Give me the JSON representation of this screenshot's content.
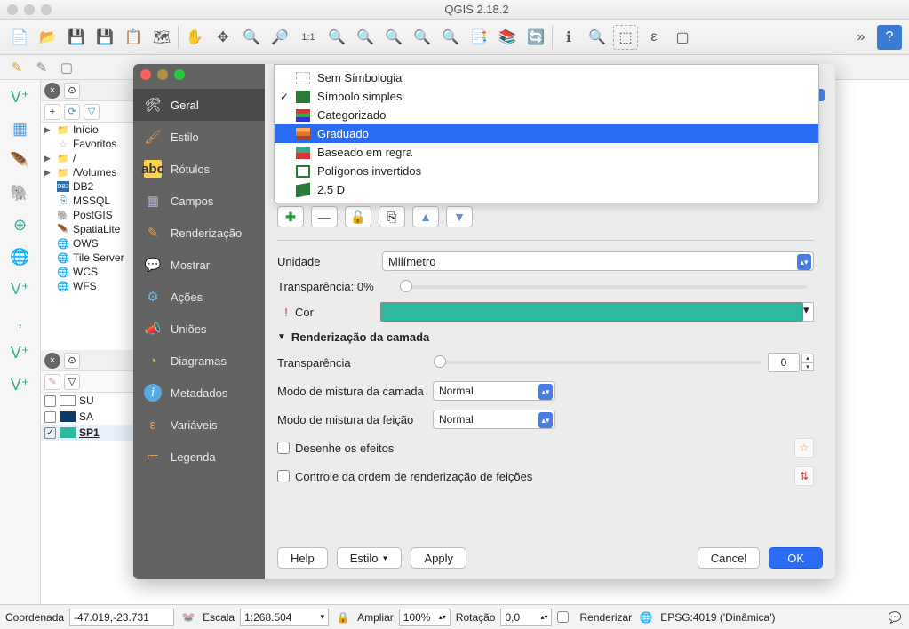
{
  "app_title": "QGIS 2.18.2",
  "browser_tree": {
    "items": [
      {
        "label": "Início",
        "icon": "folder",
        "expand": "▶"
      },
      {
        "label": "Favoritos",
        "icon": "star"
      },
      {
        "label": "/",
        "icon": "folder",
        "expand": "▶"
      },
      {
        "label": "/Volumes",
        "icon": "folder",
        "expand": "▶"
      },
      {
        "label": "DB2",
        "icon": "db2"
      },
      {
        "label": "MSSQL",
        "icon": "mssql"
      },
      {
        "label": "PostGIS",
        "icon": "postgis"
      },
      {
        "label": "SpatiaLite",
        "icon": "spatialite"
      },
      {
        "label": "OWS",
        "icon": "globe"
      },
      {
        "label": "Tile Server",
        "icon": "globe"
      },
      {
        "label": "WCS",
        "icon": "globe"
      },
      {
        "label": "WFS",
        "icon": "globe"
      }
    ]
  },
  "layers": [
    {
      "label": "SU",
      "checked": false,
      "color": "#ffffff"
    },
    {
      "label": "SA",
      "checked": false,
      "color": "#103a66"
    },
    {
      "label": "SP1",
      "checked": true,
      "color": "#2fb8a0",
      "underline": true
    }
  ],
  "dialog": {
    "sidebar": [
      {
        "id": "geral",
        "label": "Geral",
        "icon": "wrench"
      },
      {
        "id": "estilo",
        "label": "Estilo",
        "icon": "paint"
      },
      {
        "id": "rotulos",
        "label": "Rótulos",
        "icon": "abc"
      },
      {
        "id": "campos",
        "label": "Campos",
        "icon": "grid"
      },
      {
        "id": "renderizacao",
        "label": "Renderização",
        "icon": "render"
      },
      {
        "id": "mostrar",
        "label": "Mostrar",
        "icon": "chat"
      },
      {
        "id": "acoes",
        "label": "Ações",
        "icon": "gear"
      },
      {
        "id": "unioes",
        "label": "Uniões",
        "icon": "speaker"
      },
      {
        "id": "diagramas",
        "label": "Diagramas",
        "icon": "pie"
      },
      {
        "id": "metadados",
        "label": "Metadados",
        "icon": "info"
      },
      {
        "id": "variaveis",
        "label": "Variáveis",
        "icon": "var"
      },
      {
        "id": "legenda",
        "label": "Legenda",
        "icon": "legend"
      }
    ],
    "active_sidebar": "estilo",
    "symbology_dropdown": {
      "options": [
        {
          "label": "Sem Símbologia",
          "icon": "none"
        },
        {
          "label": "Símbolo simples",
          "icon": "single",
          "checked": true
        },
        {
          "label": "Categorizado",
          "icon": "categ"
        },
        {
          "label": "Graduado",
          "icon": "grad",
          "selected": true
        },
        {
          "label": "Baseado em regra",
          "icon": "rule"
        },
        {
          "label": "Polígonos invertidos",
          "icon": "invert"
        },
        {
          "label": "2.5 D",
          "icon": "25d"
        }
      ]
    },
    "unidade_label": "Unidade",
    "unidade_value": "Milímetro",
    "transp_label": "Transparência: 0%",
    "cor_label": "Cor",
    "cor_value": "#2fb8a0",
    "render_section": "Renderização da camada",
    "transp2_label": "Transparência",
    "transp2_value": "0",
    "blend_layer_label": "Modo de mistura da camada",
    "blend_layer_value": "Normal",
    "blend_feat_label": "Modo de mistura da feição",
    "blend_feat_value": "Normal",
    "draw_effects_label": "Desenhe os efeitos",
    "order_label": "Controle da ordem de renderização de feições",
    "buttons": {
      "help": "Help",
      "style": "Estilo",
      "apply": "Apply",
      "cancel": "Cancel",
      "ok": "OK"
    }
  },
  "statusbar": {
    "coord_label": "Coordenada",
    "coord_value": "-47.019,-23.731",
    "scale_label": "Escala",
    "scale_value": "1:268.504",
    "ampliar_label": "Ampliar",
    "ampliar_value": "100%",
    "rot_label": "Rotação",
    "rot_value": "0,0",
    "render_label": "Renderizar",
    "crs_label": "EPSG:4019 ('Dinâmica')"
  }
}
